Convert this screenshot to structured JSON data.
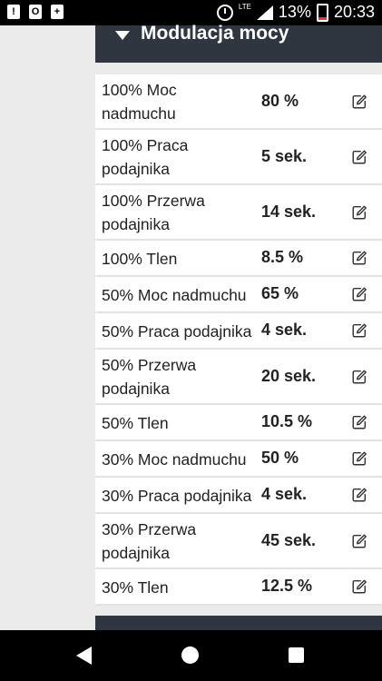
{
  "status_bar": {
    "battery_percent": "13%",
    "time": "20:33",
    "network": "LTE",
    "icons": [
      "alert-icon",
      "outlook-icon",
      "battery-charging-icon",
      "alarm-icon",
      "signal-icon",
      "battery-icon"
    ]
  },
  "panel": {
    "title": "Modulacja mocy",
    "rows": [
      {
        "label_line1": "100% Moc",
        "label_line2": "nadmuchu",
        "value": "80 %"
      },
      {
        "label_line1": "100% Praca",
        "label_line2": "podajnika",
        "value": "5 sek."
      },
      {
        "label_line1": "100% Przerwa",
        "label_line2": "podajnika",
        "value": "14 sek."
      },
      {
        "label_line1": "100% Tlen",
        "label_line2": "",
        "value": "8.5 %"
      },
      {
        "label_line1": "50% Moc nadmuchu",
        "label_line2": "",
        "value": "65 %"
      },
      {
        "label_line1": "50% Praca podajnika",
        "label_line2": "",
        "value": "4 sek."
      },
      {
        "label_line1": "50% Przerwa",
        "label_line2": "podajnika",
        "value": "20 sek."
      },
      {
        "label_line1": "50% Tlen",
        "label_line2": "",
        "value": "10.5 %"
      },
      {
        "label_line1": "30% Moc nadmuchu",
        "label_line2": "",
        "value": "50 %"
      },
      {
        "label_line1": "30% Praca podajnika",
        "label_line2": "",
        "value": "4 sek."
      },
      {
        "label_line1": "30% Przerwa",
        "label_line2": "podajnika",
        "value": "45 sek."
      },
      {
        "label_line1": "30% Tlen",
        "label_line2": "",
        "value": "12.5 %"
      }
    ]
  },
  "colors": {
    "header_bg": "#2f3640",
    "page_bg": "#ebebeb",
    "row_bg": "#ffffff"
  }
}
